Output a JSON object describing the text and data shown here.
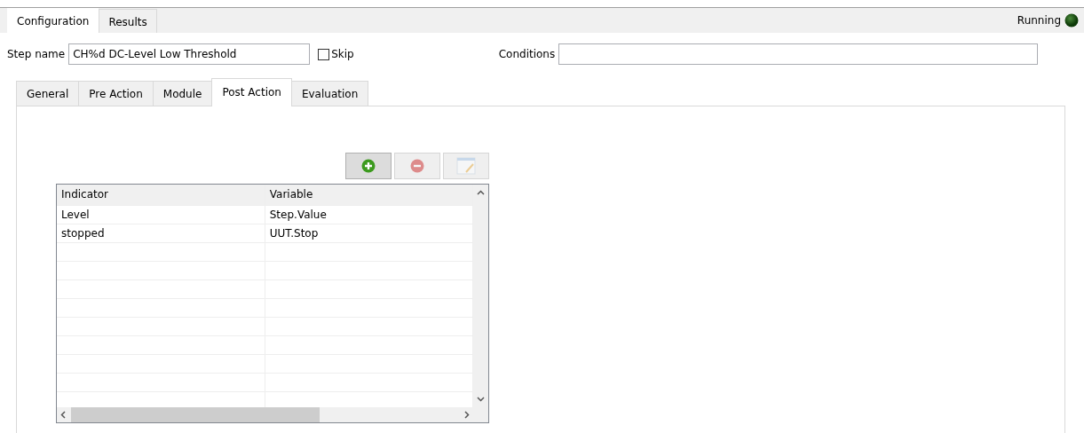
{
  "outer_tabs": [
    {
      "label": "Configuration",
      "selected": true
    },
    {
      "label": "Results",
      "selected": false
    }
  ],
  "status": {
    "label": "Running",
    "on": true
  },
  "step_name": {
    "label": "Step name",
    "value": "CH%d DC-Level Low Threshold"
  },
  "skip": {
    "label": "Skip",
    "checked": false
  },
  "conditions": {
    "label": "Conditions"
  },
  "inner_tabs": [
    {
      "label": "General",
      "selected": false
    },
    {
      "label": "Pre Action",
      "selected": false
    },
    {
      "label": "Module",
      "selected": false
    },
    {
      "label": "Post Action",
      "selected": true
    },
    {
      "label": "Evaluation",
      "selected": false
    }
  ],
  "toolbar": [
    {
      "kind": "add",
      "disabled": false
    },
    {
      "kind": "remove",
      "disabled": true
    },
    {
      "kind": "edit",
      "disabled": true
    }
  ],
  "table": {
    "columns": [
      "Indicator",
      "Variable"
    ],
    "rows": [
      [
        "Level",
        "Step.Value"
      ],
      [
        "stopped",
        "UUT.Stop"
      ]
    ]
  }
}
